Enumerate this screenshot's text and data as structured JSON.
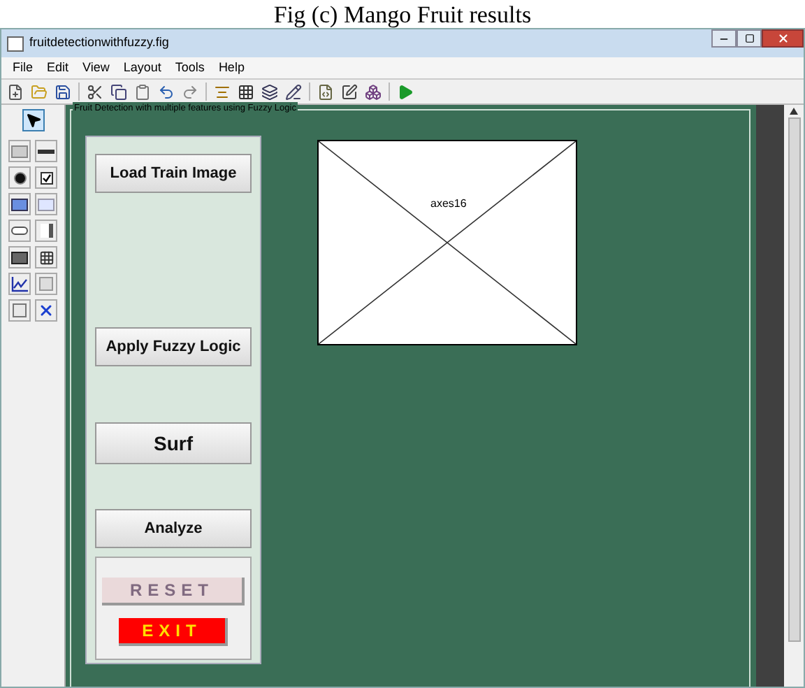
{
  "caption": "Fig (c) Mango Fruit results",
  "window": {
    "title": "fruitdetectionwithfuzzy.fig"
  },
  "menu": [
    "File",
    "Edit",
    "View",
    "Layout",
    "Tools",
    "Help"
  ],
  "palette": [
    {
      "kind": "select",
      "selected": true
    },
    {
      "kind": "push",
      "selected": false
    },
    {
      "kind": "slider",
      "selected": false
    },
    {
      "kind": "radio",
      "selected": false
    },
    {
      "kind": "check",
      "selected": false
    },
    {
      "kind": "edit",
      "selected": false
    },
    {
      "kind": "text",
      "selected": false
    },
    {
      "kind": "popup",
      "selected": false
    },
    {
      "kind": "listbox",
      "selected": false
    },
    {
      "kind": "toggle",
      "selected": false
    },
    {
      "kind": "table",
      "selected": false
    },
    {
      "kind": "axes",
      "selected": false
    },
    {
      "kind": "panel",
      "selected": false
    },
    {
      "kind": "group",
      "selected": false
    },
    {
      "kind": "activex",
      "selected": false
    }
  ],
  "panel": {
    "title": "Fruit Detection with multiple features using Fuzzy Logic"
  },
  "buttons": [
    {
      "label": "Load Train Image",
      "kind": "normal"
    },
    {
      "label": "Apply Fuzzy Logic",
      "kind": "normal"
    },
    {
      "label": "Surf",
      "kind": "large"
    },
    {
      "label": "Analyze",
      "kind": "normal"
    }
  ],
  "sub_buttons": [
    {
      "label": "RESET",
      "kind": "reset"
    },
    {
      "label": "EXIT",
      "kind": "exit"
    }
  ],
  "axes": {
    "label": "axes16"
  }
}
